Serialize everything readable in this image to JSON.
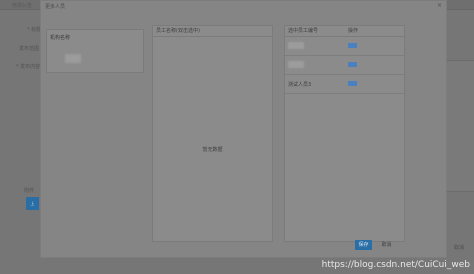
{
  "background": {
    "title": "修改公告",
    "labels": [
      "* 标题",
      "发布范围",
      "* 发布内容",
      "附件"
    ],
    "upload_label": "上"
  },
  "dialog": {
    "title": "更多人员",
    "close": "×",
    "org_panel": {
      "header": "机构名称"
    },
    "staff_panel": {
      "header": "员工名称(双击选中)",
      "empty_text": "暂无数据"
    },
    "selected_panel": {
      "col_name": "选中员工编号",
      "col_action": "操作",
      "rows": [
        {
          "name": "",
          "action": "删除"
        },
        {
          "name": "",
          "action": "删除"
        },
        {
          "name": "测试人员3",
          "action": "删除"
        }
      ]
    },
    "save_label": "保存",
    "cancel_label": "取消"
  },
  "right_side": {
    "label": "取消"
  },
  "watermark": "https://blog.csdn.net/CuiCui_web"
}
